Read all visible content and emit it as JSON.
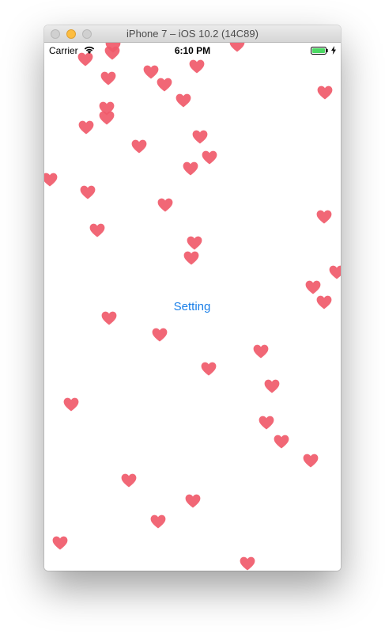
{
  "window": {
    "title": "iPhone 7 – iOS 10.2 (14C89)"
  },
  "status_bar": {
    "carrier": "Carrier",
    "time": "6:10 PM",
    "wifi_icon": "wifi-icon",
    "battery_icon": "battery-icon",
    "charging_icon": "bolt-icon",
    "battery_color": "#4cd964"
  },
  "main": {
    "setting_label": "Setting",
    "link_color": "#1a7fe8"
  },
  "hearts": {
    "icon": "heart-icon",
    "color": "#f05a6a"
  }
}
